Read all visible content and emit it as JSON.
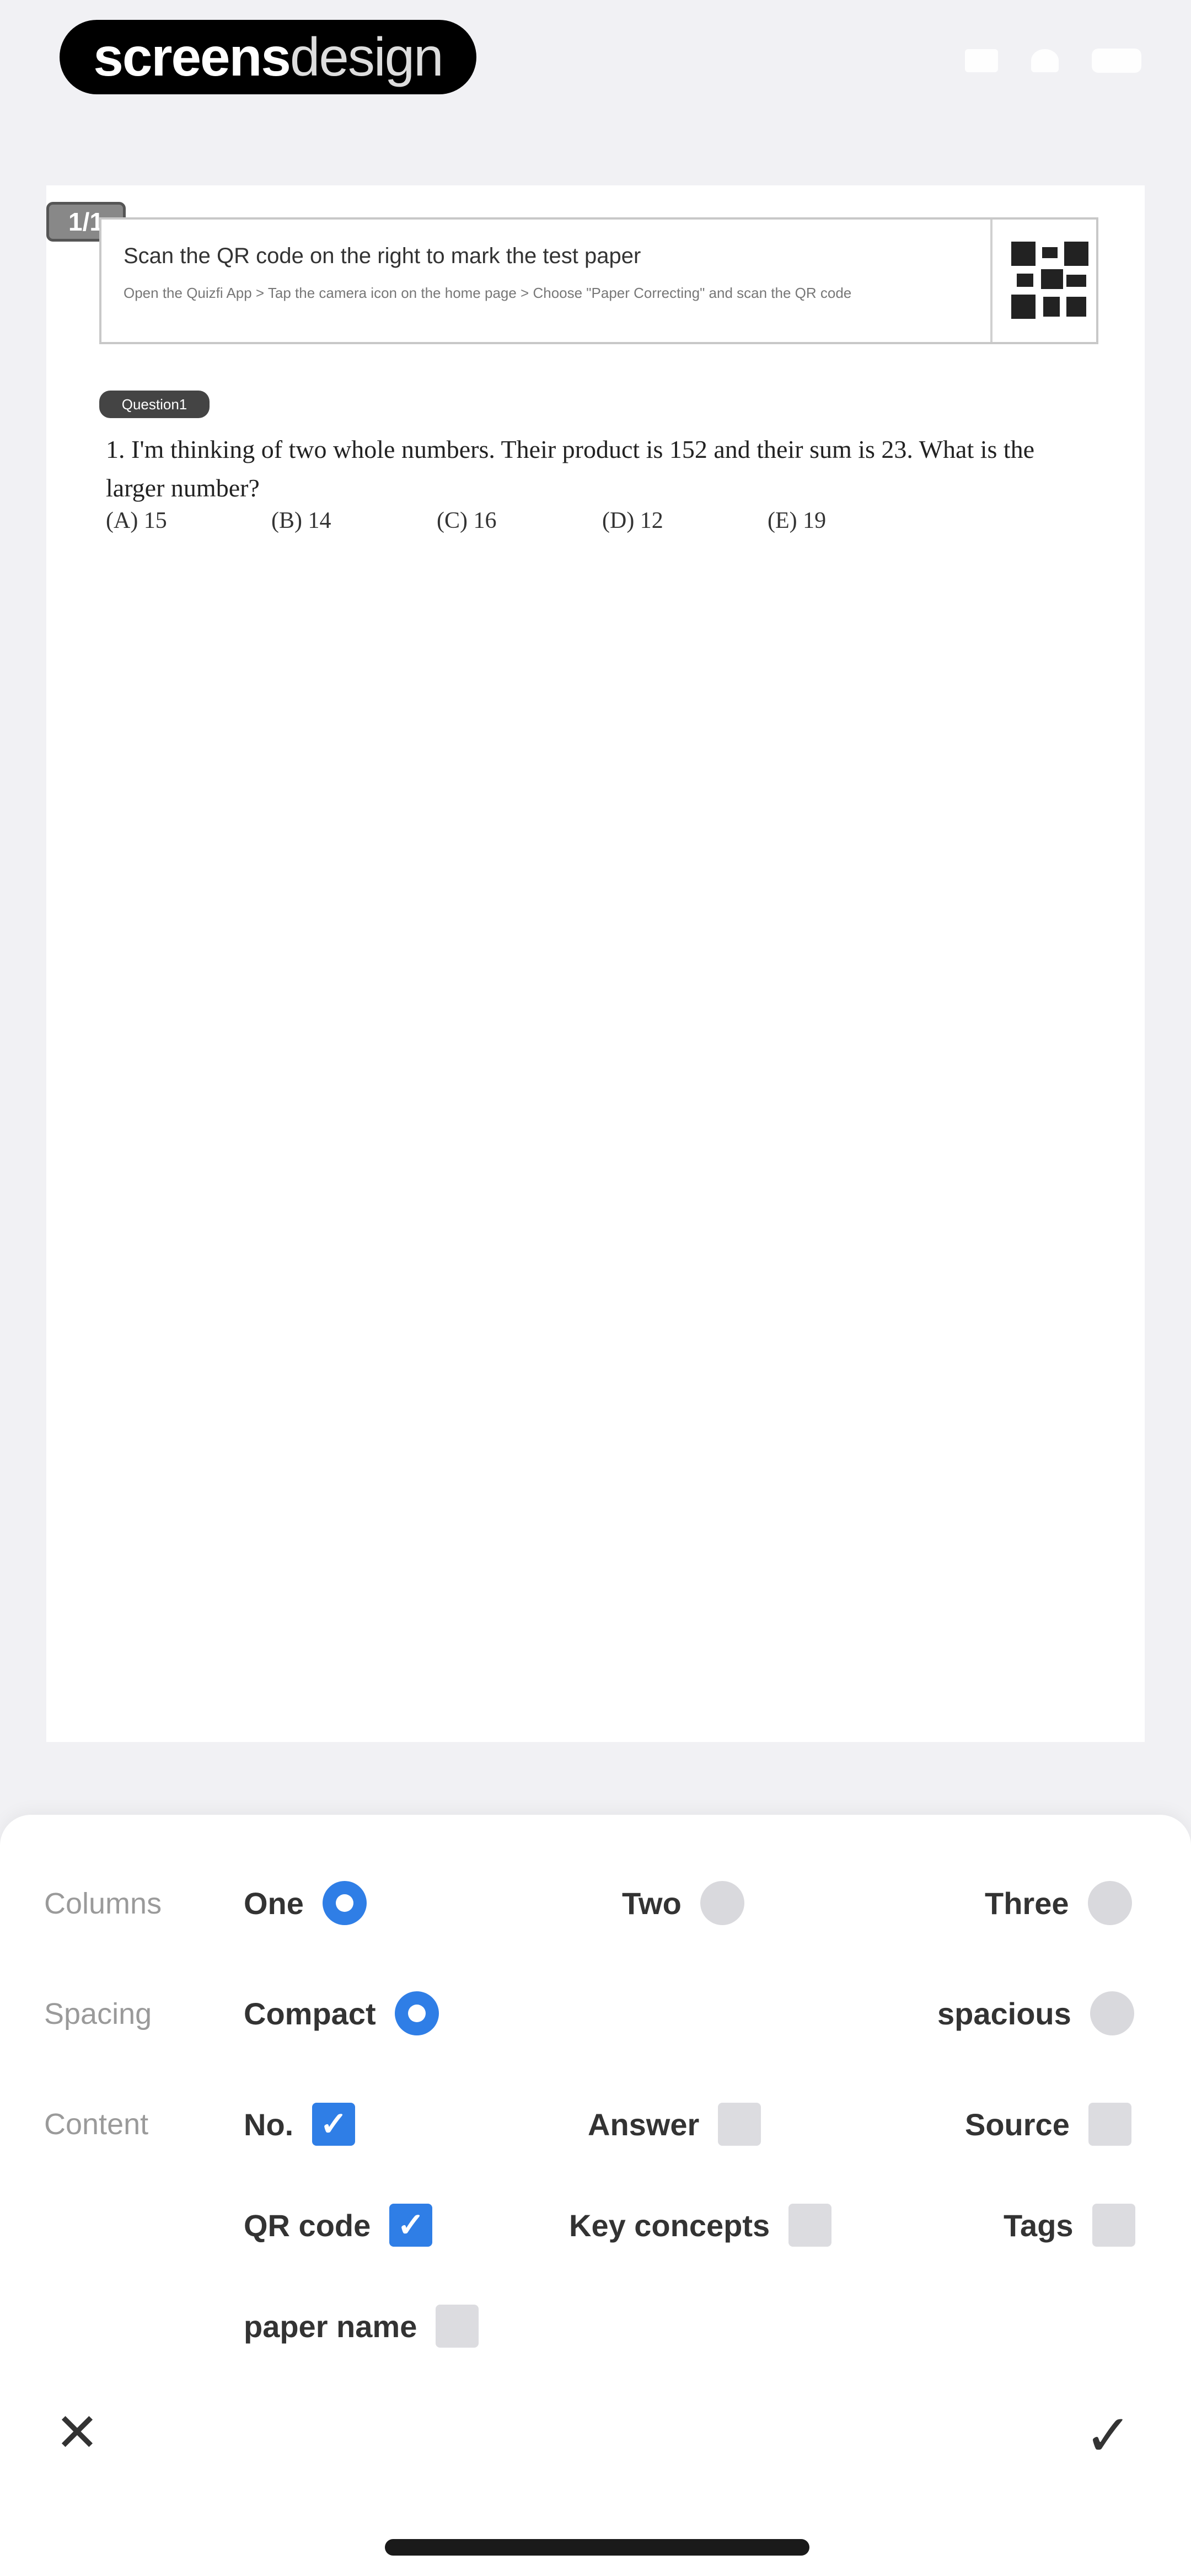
{
  "brand": {
    "strong": "screens",
    "light": "design"
  },
  "paper": {
    "page_badge": "1/1",
    "qr_card": {
      "title": "Scan the QR code on the right to mark the test paper",
      "subtitle": "Open the Quizfi App > Tap the camera icon on the home page > Choose \"Paper Correcting\" and scan the QR code"
    },
    "question_tag": "Question1",
    "question_text": "1. I'm thinking of two whole numbers. Their product is 152 and their sum is 23. What is the larger number?",
    "options": [
      "(A) 15",
      "(B) 14",
      "(C) 16",
      "(D) 12",
      "(E) 19"
    ]
  },
  "settings": {
    "columns": {
      "label": "Columns",
      "options": [
        {
          "label": "One",
          "selected": true
        },
        {
          "label": "Two",
          "selected": false
        },
        {
          "label": "Three",
          "selected": false
        }
      ]
    },
    "spacing": {
      "label": "Spacing",
      "options": [
        {
          "label": "Compact",
          "selected": true
        },
        {
          "label": "spacious",
          "selected": false
        }
      ]
    },
    "content": {
      "label": "Content",
      "items": [
        {
          "label": "No.",
          "checked": true
        },
        {
          "label": "Answer",
          "checked": false
        },
        {
          "label": "Source",
          "checked": false
        },
        {
          "label": "QR code",
          "checked": true
        },
        {
          "label": "Key concepts",
          "checked": false
        },
        {
          "label": "Tags",
          "checked": false
        },
        {
          "label": "paper name",
          "checked": false
        }
      ]
    }
  },
  "actions": {
    "cancel_icon": "close-icon",
    "confirm_icon": "checkmark-icon"
  },
  "colors": {
    "accent": "#2f7ee6",
    "sheet_bg": "#ffffff",
    "page_bg": "#f1f1f4"
  }
}
